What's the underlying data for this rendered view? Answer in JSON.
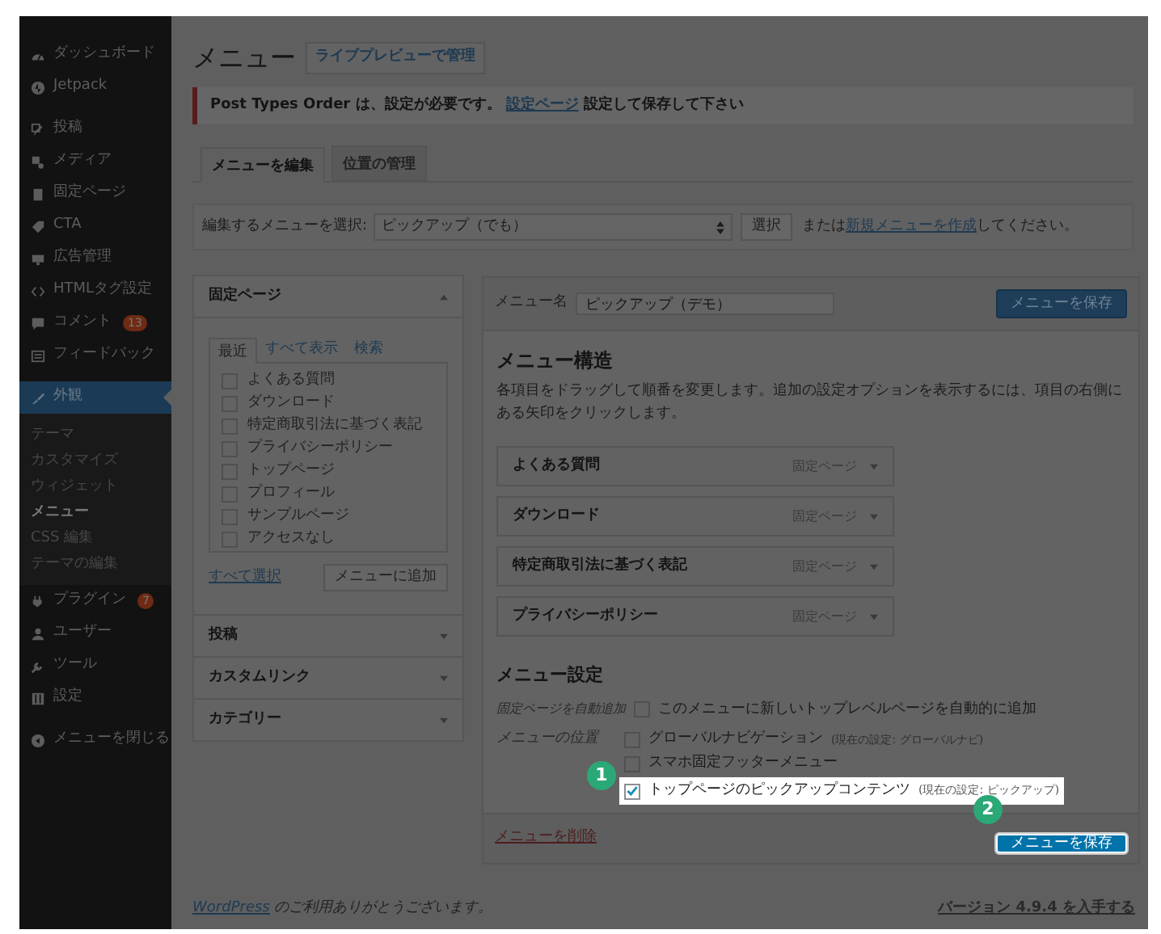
{
  "sidebar": {
    "sections": [
      {
        "items": [
          {
            "label": "ダッシュボード",
            "selected": false
          },
          {
            "label": "Jetpack",
            "selected": false
          }
        ]
      },
      {
        "items": [
          {
            "label": "投稿",
            "selected": false
          },
          {
            "label": "メディア",
            "selected": false
          },
          {
            "label": "固定ページ",
            "selected": false
          },
          {
            "label": "CTA",
            "selected": false
          },
          {
            "label": "広告管理",
            "selected": false
          },
          {
            "label": "HTMLタグ設定",
            "selected": false
          },
          {
            "label": "コメント",
            "selected": false,
            "badge": "13"
          },
          {
            "label": "フィードバック",
            "selected": false
          }
        ]
      },
      {
        "items": [
          {
            "label": "外観",
            "selected": true,
            "children": [
              {
                "label": "テーマ",
                "selected": false
              },
              {
                "label": "カスタマイズ",
                "selected": false
              },
              {
                "label": "ウィジェット",
                "selected": false
              },
              {
                "label": "メニュー",
                "selected": true
              },
              {
                "label": "CSS 編集",
                "selected": false
              },
              {
                "label": "テーマの編集",
                "selected": false
              }
            ]
          },
          {
            "label": "プラグイン",
            "selected": false,
            "badge": "7"
          },
          {
            "label": "ユーザー",
            "selected": false
          },
          {
            "label": "ツール",
            "selected": false
          },
          {
            "label": "設定",
            "selected": false
          }
        ]
      },
      {
        "items": [
          {
            "label": "メニューを閉じる",
            "selected": false
          }
        ]
      }
    ]
  },
  "page": {
    "title": "メニュー",
    "action": "ライブプレビューで管理"
  },
  "notice": {
    "text": "Post Types Order は、設定が必要です。",
    "link": "設定ページ",
    "after": "設定して保存して下さい"
  },
  "tabs": [
    {
      "label": "メニューを編集",
      "selected": true
    },
    {
      "label": "位置の管理",
      "selected": false
    }
  ],
  "select_bar": {
    "label": "編集するメニューを選択:",
    "value": "ピックアップ（でも）",
    "button": "選択",
    "or": "または",
    "link": "新規メニューを作成",
    "after": "してください。"
  },
  "accordion": [
    {
      "title": "固定ページ",
      "expanded": true,
      "tabs": [
        {
          "label": "最近",
          "selected": true
        },
        {
          "label": "すべて表示",
          "selected": false
        },
        {
          "label": "検索",
          "selected": false
        }
      ],
      "items": [
        {
          "label": "よくある質問",
          "checked": false
        },
        {
          "label": "ダウンロード",
          "checked": false
        },
        {
          "label": "特定商取引法に基づく表記",
          "checked": false
        },
        {
          "label": "プライバシーポリシー",
          "checked": false
        },
        {
          "label": "トップページ",
          "checked": false
        },
        {
          "label": "プロフィール",
          "checked": false
        },
        {
          "label": "サンプルページ",
          "checked": false
        },
        {
          "label": "アクセスなし",
          "checked": false
        }
      ],
      "select_all": "すべて選択",
      "add_button": "メニューに追加"
    },
    {
      "title": "投稿",
      "expanded": false
    },
    {
      "title": "カスタムリンク",
      "expanded": false
    },
    {
      "title": "カテゴリー",
      "expanded": false
    }
  ],
  "editor": {
    "name_label": "メニュー名",
    "name_value": "ピックアップ（デモ）",
    "save_button": "メニューを保存",
    "structure_title": "メニュー構造",
    "structure_help": "各項目をドラッグして順番を変更します。追加の設定オプションを表示するには、項目の右側にある矢印をクリックします。",
    "menu_items": [
      {
        "label": "よくある質問",
        "type": "固定ページ"
      },
      {
        "label": "ダウンロード",
        "type": "固定ページ"
      },
      {
        "label": "特定商取引法に基づく表記",
        "type": "固定ページ"
      },
      {
        "label": "プライバシーポリシー",
        "type": "固定ページ"
      }
    ],
    "settings_title": "メニュー設定",
    "auto_add": {
      "label": "固定ページを自動追加",
      "option": "このメニューに新しいトップレベルページを自動的に追加",
      "checked": false
    },
    "locations_label": "メニューの位置",
    "locations": [
      {
        "label": "グローバルナビゲーション",
        "note": "(現在の設定: グローバルナビ)",
        "checked": false,
        "highlighted": false
      },
      {
        "label": "スマホ固定フッターメニュー",
        "checked": false,
        "highlighted": false
      },
      {
        "label": "トップページのピックアップコンテンツ",
        "note": "(現在の設定: ピックアップ)",
        "checked": true,
        "highlighted": true,
        "marker": "1"
      }
    ],
    "delete_link": "メニューを削除",
    "footer_save": {
      "label": "メニューを保存",
      "highlighted": true,
      "marker": "2"
    }
  },
  "footer": {
    "link": "WordPress",
    "text": "のご利用ありがとうございます。",
    "version": "バージョン 4.9.4 を入手する"
  }
}
